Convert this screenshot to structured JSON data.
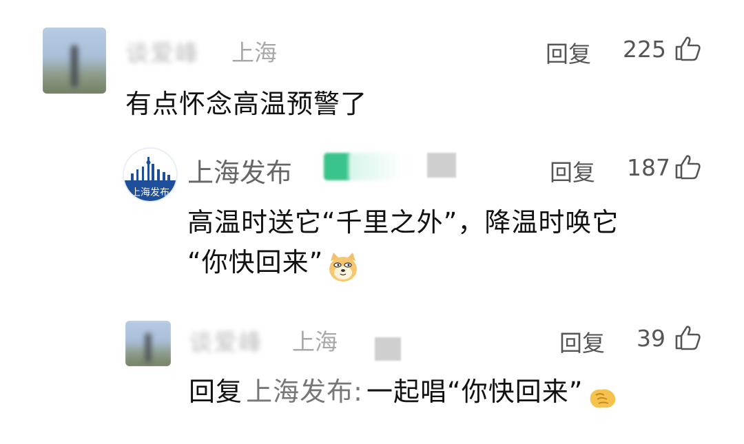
{
  "comments": [
    {
      "username": "谈爱峰",
      "location": "上海",
      "reply_label": "回复",
      "likes": "225",
      "text": "有点怀念高温预警了"
    }
  ],
  "replies": [
    {
      "username": "上海发布",
      "avatar_text": "上海发布",
      "reply_label": "回复",
      "likes": "187",
      "text_line1": "高温时送它“千里之外”，降温时唤它",
      "text_line2": "“你快回来”",
      "emoji": "doge-icon"
    },
    {
      "username": "谈爱峰",
      "location": "上海",
      "reply_label": "回复",
      "likes": "39",
      "reply_prefix": "回复",
      "reply_target": "上海发布:",
      "text": "一起唱“你快回来”",
      "emoji": "wave-hand-icon"
    }
  ],
  "colors": {
    "text_primary": "#111111",
    "text_secondary": "#555555",
    "text_muted": "#a8a8a8",
    "badge_green": "#3ac38b",
    "official_blue": "#1f4f9a"
  }
}
